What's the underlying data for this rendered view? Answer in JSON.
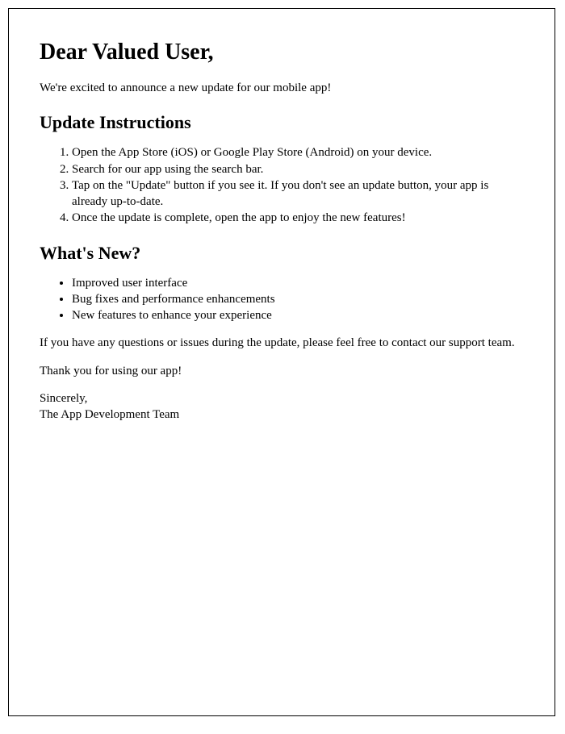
{
  "greeting": "Dear Valued User,",
  "intro": "We're excited to announce a new update for our mobile app!",
  "instructions_heading": "Update Instructions",
  "instructions": [
    "Open the App Store (iOS) or Google Play Store (Android) on your device.",
    "Search for our app using the search bar.",
    "Tap on the \"Update\" button if you see it. If you don't see an update button, your app is already up-to-date.",
    "Once the update is complete, open the app to enjoy the new features!"
  ],
  "whatsnew_heading": "What's New?",
  "whatsnew": [
    "Improved user interface",
    "Bug fixes and performance enhancements",
    "New features to enhance your experience"
  ],
  "support": "If you have any questions or issues during the update, please feel free to contact our support team.",
  "thanks": "Thank you for using our app!",
  "closing": "Sincerely,",
  "signature": "The App Development Team"
}
